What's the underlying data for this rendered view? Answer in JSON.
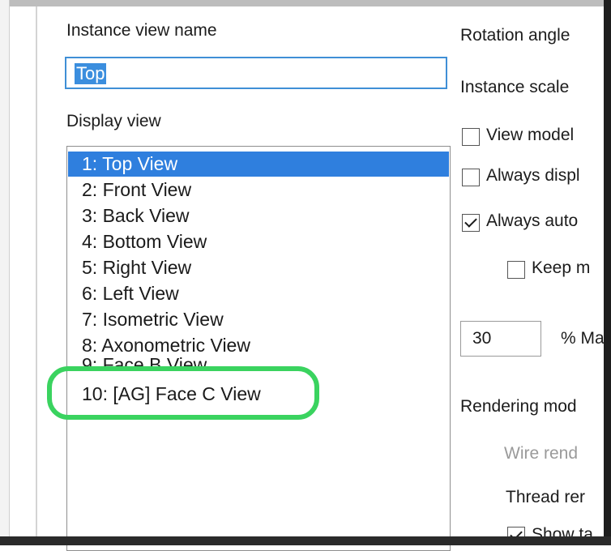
{
  "left_panel": {
    "instance_view_name_label": "Instance view name",
    "instance_view_name_value": "Top",
    "display_view_label": "Display view",
    "display_views": [
      "1: Top View",
      "2: Front View",
      "3: Back View",
      "4: Bottom View",
      "5: Right View",
      "6: Left View",
      "7: Isometric View",
      "8: Axonometric View",
      "9: Face B View",
      "10: [AG] Face C View"
    ],
    "selected_view": "1: Top View",
    "highlighted_view": "10: [AG] Face C View"
  },
  "right_panel": {
    "rotation_angle_label": "Rotation angle",
    "instance_scale_label": "Instance scale",
    "view_model_label": "View model",
    "always_display_label": "Always displ",
    "always_auto_label": "Always auto",
    "keep_label": "Keep m",
    "percent_value": "30",
    "percent_label": "% Ma",
    "rendering_mode_label": "Rendering mod",
    "wire_render_label": "Wire rend",
    "thread_render_label": "Thread rer",
    "show_label": "Show ta",
    "view_model_checked": false,
    "always_display_checked": false,
    "always_auto_checked": true,
    "keep_checked": false,
    "show_checked": true
  },
  "colors": {
    "selection": "#2f7fde",
    "highlight_ring": "#3ad35f"
  }
}
